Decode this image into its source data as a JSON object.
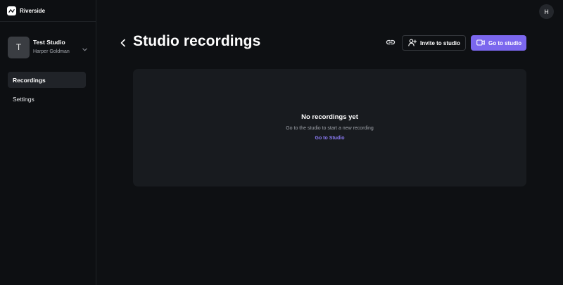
{
  "app": {
    "brand": "Riverside",
    "user_initial": "H"
  },
  "sidebar": {
    "studio": {
      "initial": "T",
      "name": "Test Studio",
      "owner": "Harper Goldman"
    },
    "items": [
      {
        "label": "Recordings",
        "active": true
      },
      {
        "label": "Settings",
        "active": false
      }
    ]
  },
  "header": {
    "title": "Studio recordings",
    "invite_label": "Invite to studio",
    "goto_label": "Go to studio"
  },
  "empty_state": {
    "title": "No recordings yet",
    "subtitle": "Go to the studio to start a new recording",
    "link": "Go to Studio"
  },
  "colors": {
    "background": "#0e1013",
    "card": "#181b1f",
    "accent": "#7b67ee",
    "accent_link": "#8b7bf5"
  },
  "icons": [
    "riverside-logo-icon",
    "chevron-down-icon",
    "back-arrow-icon",
    "link-icon",
    "add-user-icon",
    "video-camera-icon"
  ]
}
